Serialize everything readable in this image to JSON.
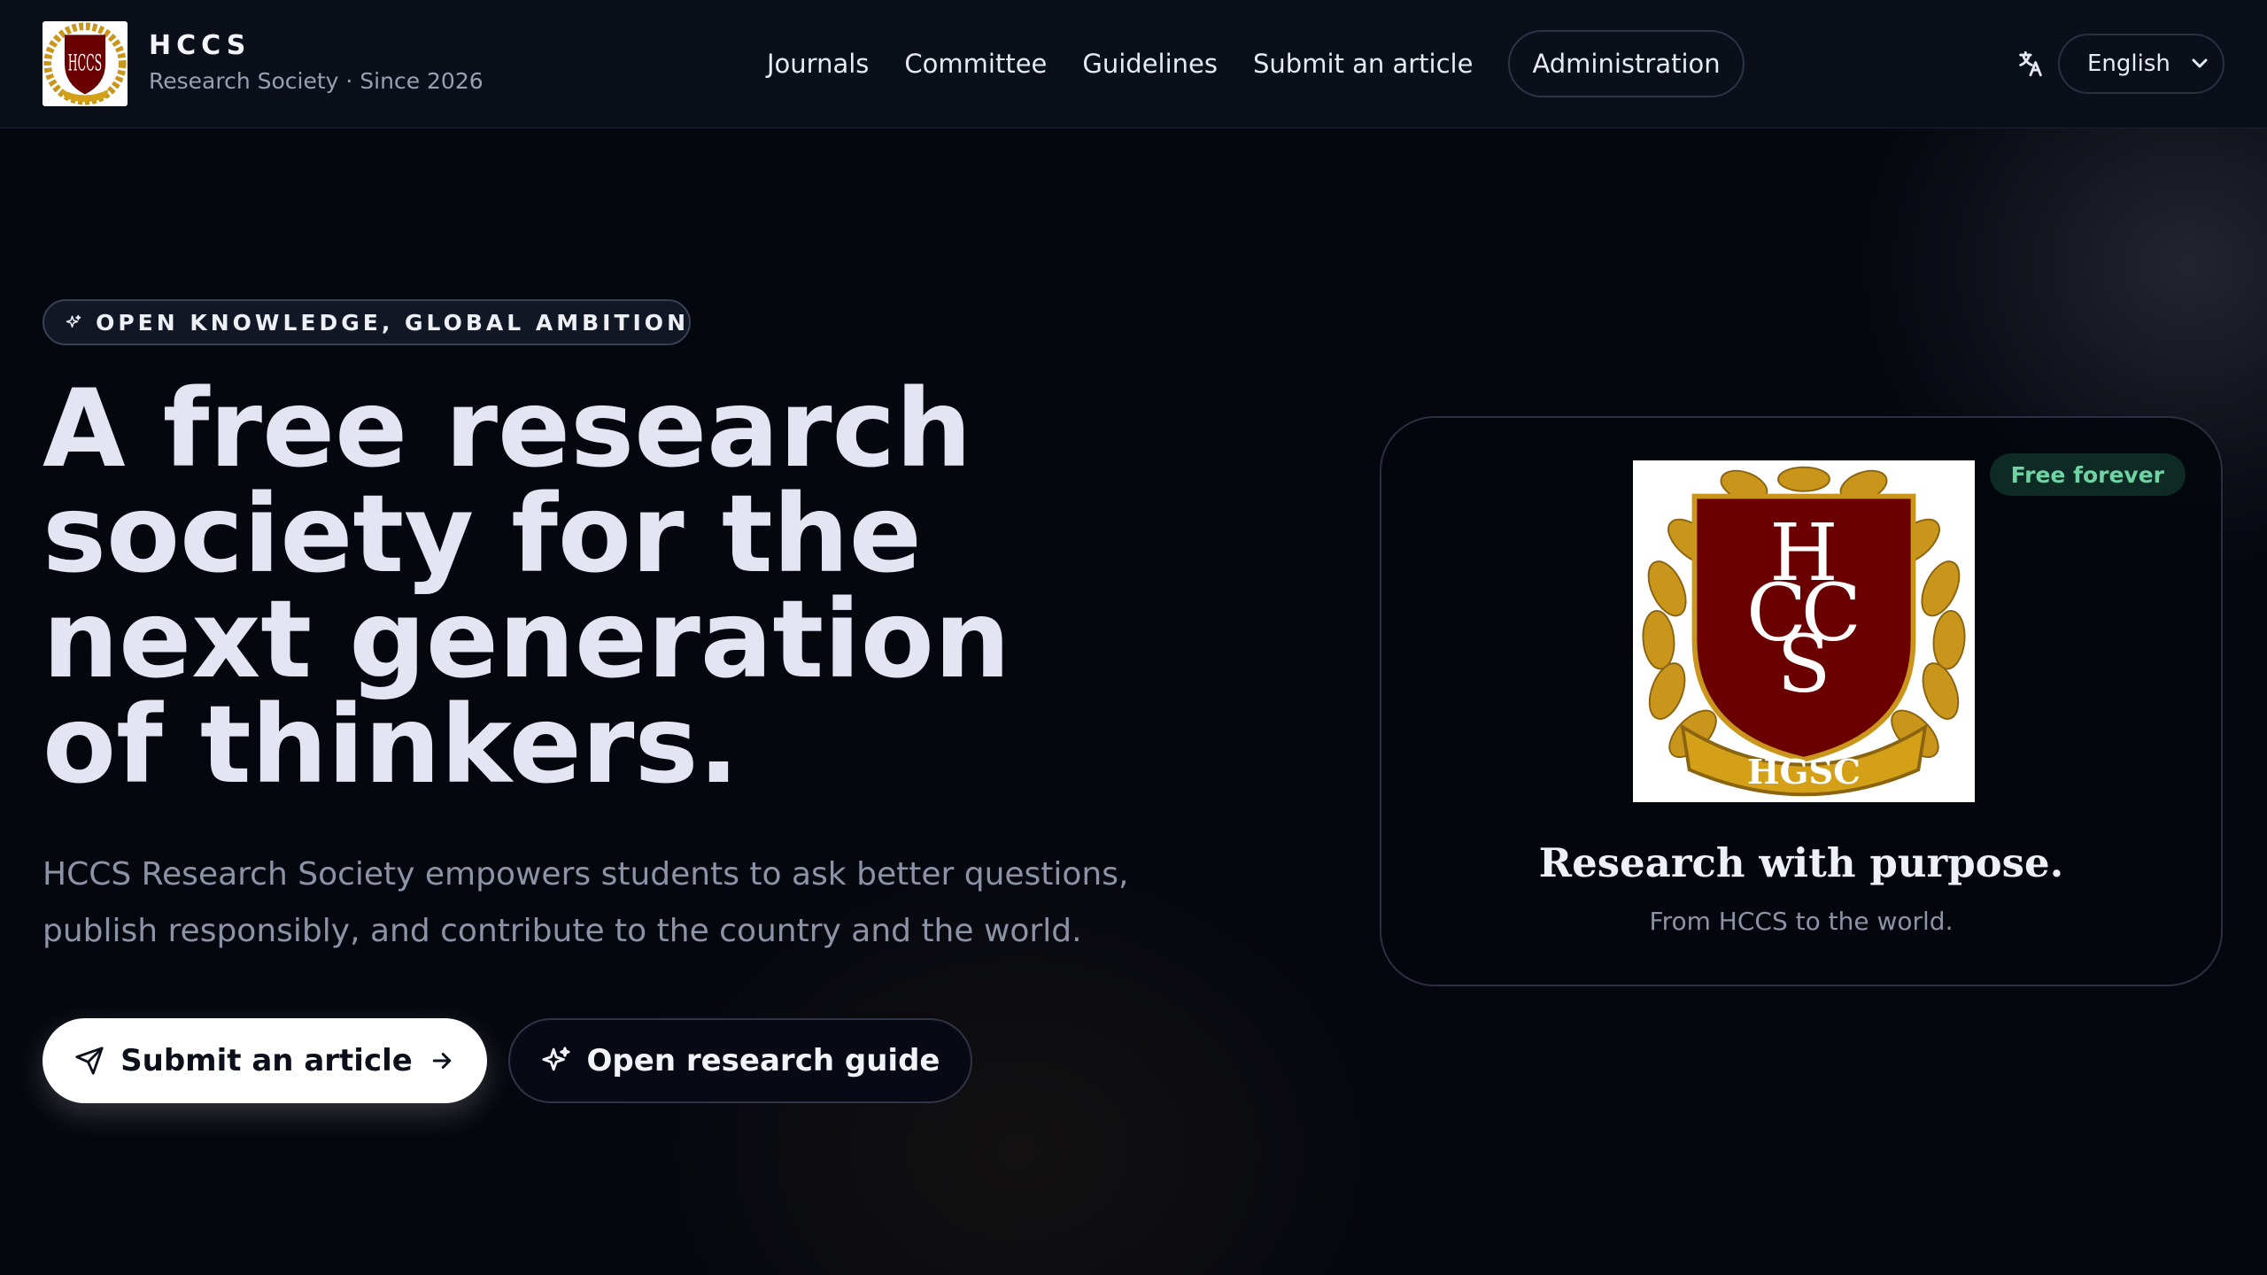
{
  "brand": {
    "name": "HCCS",
    "subtitle": "Research Society · Since 2026",
    "logo_initials": "HCCS",
    "crest_ribbon": "HGSC"
  },
  "nav": {
    "links": [
      "Journals",
      "Committee",
      "Guidelines",
      "Submit an article"
    ],
    "admin_label": "Administration"
  },
  "language": {
    "icon": "translate-icon",
    "selected": "English"
  },
  "hero": {
    "eyebrow": "OPEN KNOWLEDGE, GLOBAL AMBITION",
    "eyebrow_icon": "sparkles-icon",
    "headline_lines": [
      "A free research",
      "society for the",
      "next generation",
      "of thinkers."
    ],
    "subtext_lines": [
      "HCCS Research Society empowers students to ask better questions,",
      "publish responsibly, and contribute to the country and the world."
    ],
    "primary_cta": {
      "label": "Submit an article",
      "icon": "send-icon",
      "trailing_icon": "arrow-right-icon"
    },
    "secondary_cta": {
      "label": "Open research guide",
      "icon": "sparkles-icon"
    }
  },
  "card": {
    "badge": "Free forever",
    "title": "Research with purpose.",
    "subtitle": "From HCCS to the world."
  },
  "colors": {
    "background": "#05070f",
    "header": "#0b0f1a",
    "crest_red": "#6b0000",
    "crest_gold": "#d4a017",
    "badge_text": "#6fd3a4",
    "badge_bg": "#0d2a24"
  }
}
